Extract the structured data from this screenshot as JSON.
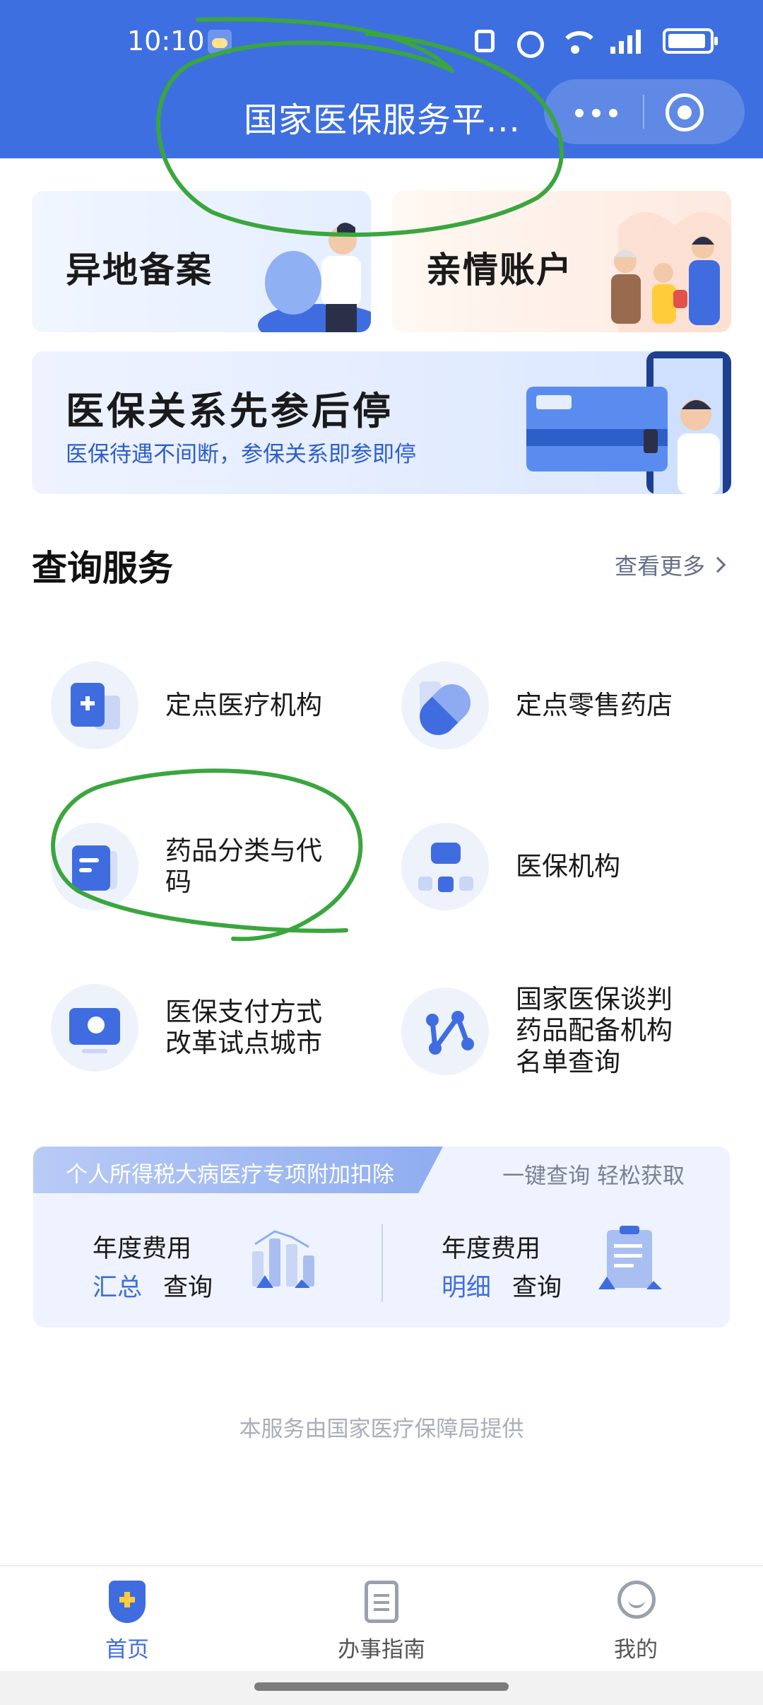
{
  "status_bar": {
    "time": "10:10"
  },
  "header": {
    "title": "国家医保服务平..."
  },
  "cards": {
    "yidi": "异地备案",
    "qinqing": "亲情账户",
    "banner_title": "医保关系先参后停",
    "banner_sub": "医保待遇不间断，参保关系即参即停"
  },
  "query": {
    "title": "查询服务",
    "see_more": "查看更多",
    "items": [
      {
        "label": "定点医疗机构",
        "icon": "hospital-icon"
      },
      {
        "label": "定点零售药店",
        "icon": "pill-icon"
      },
      {
        "label": "药品分类与代\n码",
        "icon": "document-icon"
      },
      {
        "label": "医保机构",
        "icon": "organization-icon"
      },
      {
        "label": "医保支付方式\n改革试点城市",
        "icon": "monitor-icon"
      },
      {
        "label": "国家医保谈判\n药品配备机构\n名单查询",
        "icon": "network-icon"
      }
    ]
  },
  "tax": {
    "tag": "个人所得税大病医疗专项附加扣除",
    "slogan": "一键查询 轻松获取",
    "summary": {
      "line1": "年度费用",
      "highlight": "汇总",
      "action": "查询"
    },
    "detail": {
      "line1": "年度费用",
      "highlight": "明细",
      "action": "查询"
    }
  },
  "footer_note": "本服务由国家医疗保障局提供",
  "tabs": {
    "home": "首页",
    "guide": "办事指南",
    "mine": "我的"
  },
  "colors": {
    "brand_blue": "#3e6fe0",
    "annotation_green": "#3aa63e"
  }
}
